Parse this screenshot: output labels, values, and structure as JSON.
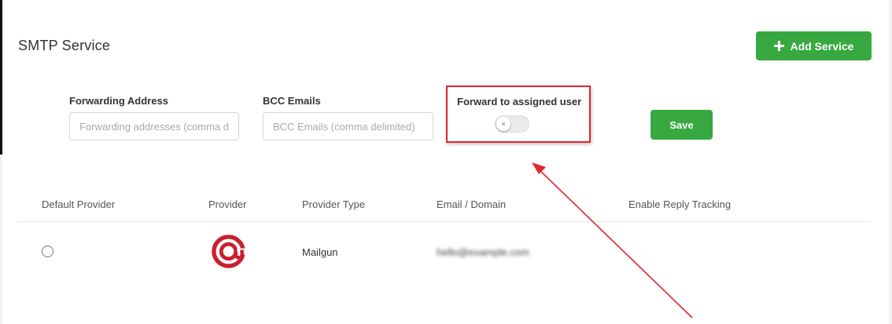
{
  "page": {
    "title": "SMTP Service"
  },
  "actions": {
    "add_service_label": "Add Service",
    "save_label": "Save"
  },
  "form": {
    "forwarding_address": {
      "label": "Forwarding Address",
      "placeholder": "Forwarding addresses (comma delimited)",
      "value": ""
    },
    "bcc_emails": {
      "label": "BCC Emails",
      "placeholder": "BCC Emails (comma delimited)",
      "value": ""
    },
    "forward_to_assigned_user": {
      "label": "Forward to assigned user",
      "enabled": false,
      "off_glyph": "×"
    }
  },
  "table": {
    "columns": [
      "Default Provider",
      "Provider",
      "Provider Type",
      "Email / Domain",
      "Enable Reply Tracking"
    ],
    "rows": [
      {
        "default": false,
        "provider_icon": "mailgun-logo-icon",
        "provider_type": "Mailgun",
        "email_domain": "hello@example.com",
        "reply_tracking": ""
      }
    ]
  },
  "colors": {
    "accent_green": "#37a940",
    "highlight_red": "#e0262b",
    "mailgun_red": "#c8202f"
  }
}
